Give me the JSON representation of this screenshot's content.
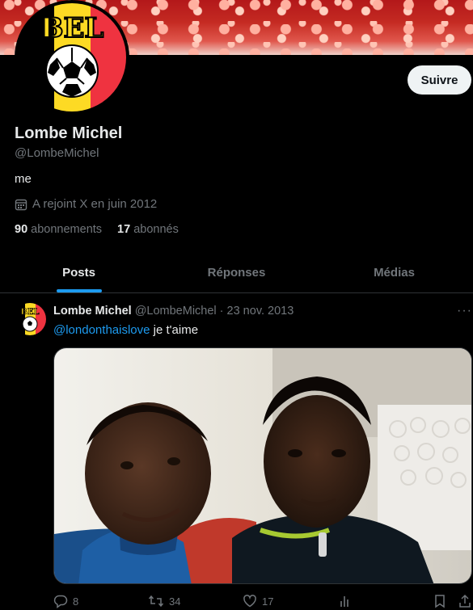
{
  "profile": {
    "follow_label": "Suivre",
    "name": "Lombe Michel",
    "handle": "@LombeMichel",
    "bio": "me",
    "joined": "A rejoint X en juin 2012",
    "following_count": "90",
    "following_label": "abonnements",
    "followers_count": "17",
    "followers_label": "abonnés",
    "avatar_logo_text": "BEL"
  },
  "tabs": [
    {
      "label": "Posts",
      "active": true
    },
    {
      "label": "Réponses",
      "active": false
    },
    {
      "label": "Médias",
      "active": false
    }
  ],
  "tweet": {
    "name": "Lombe Michel",
    "meta": "@LombeMichel · 23 nov. 2013",
    "mention": "@londonthaislove",
    "text": " je t'aime",
    "more": "···",
    "actions": {
      "replies": "8",
      "retweets": "34",
      "likes": "17"
    }
  },
  "colors": {
    "accent": "#1d9bf0",
    "text": "#e7e9ea",
    "muted": "#71767b",
    "flag_black": "#000000",
    "flag_yellow": "#fdda24",
    "flag_red": "#ef3340"
  }
}
